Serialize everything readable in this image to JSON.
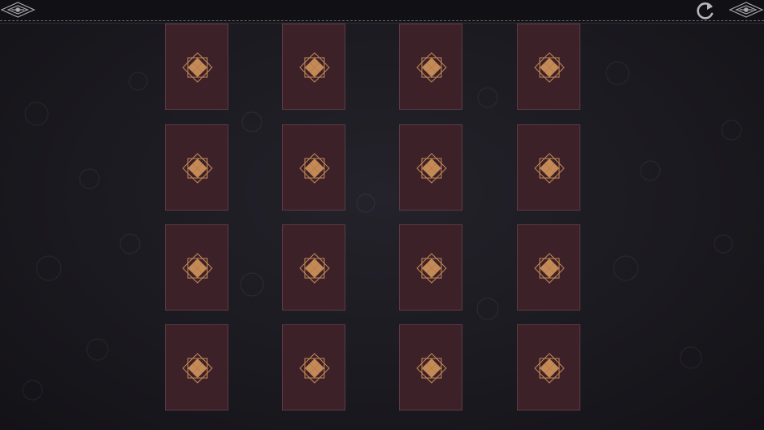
{
  "game": {
    "title": "",
    "colors": {
      "background": "#1b1a20",
      "topbar": "#111014",
      "card_back": "#3c2129",
      "card_border": "#5e3a43",
      "emblem": "#c48a55"
    },
    "toolbar": {
      "restart_icon": "restart-icon",
      "left_ornament": "ornament-icon",
      "right_ornament": "ornament-icon"
    },
    "grid": {
      "rows": 4,
      "columns": 4,
      "cards": [
        {
          "state": "face-down",
          "emblem": "diamond-emblem-icon"
        },
        {
          "state": "face-down",
          "emblem": "diamond-emblem-icon"
        },
        {
          "state": "face-down",
          "emblem": "diamond-emblem-icon"
        },
        {
          "state": "face-down",
          "emblem": "diamond-emblem-icon"
        },
        {
          "state": "face-down",
          "emblem": "diamond-emblem-icon"
        },
        {
          "state": "face-down",
          "emblem": "diamond-emblem-icon"
        },
        {
          "state": "face-down",
          "emblem": "diamond-emblem-icon"
        },
        {
          "state": "face-down",
          "emblem": "diamond-emblem-icon"
        },
        {
          "state": "face-down",
          "emblem": "diamond-emblem-icon"
        },
        {
          "state": "face-down",
          "emblem": "diamond-emblem-icon"
        },
        {
          "state": "face-down",
          "emblem": "diamond-emblem-icon"
        },
        {
          "state": "face-down",
          "emblem": "diamond-emblem-icon"
        },
        {
          "state": "face-down",
          "emblem": "diamond-emblem-icon"
        },
        {
          "state": "face-down",
          "emblem": "diamond-emblem-icon"
        },
        {
          "state": "face-down",
          "emblem": "diamond-emblem-icon"
        },
        {
          "state": "face-down",
          "emblem": "diamond-emblem-icon"
        }
      ]
    }
  }
}
